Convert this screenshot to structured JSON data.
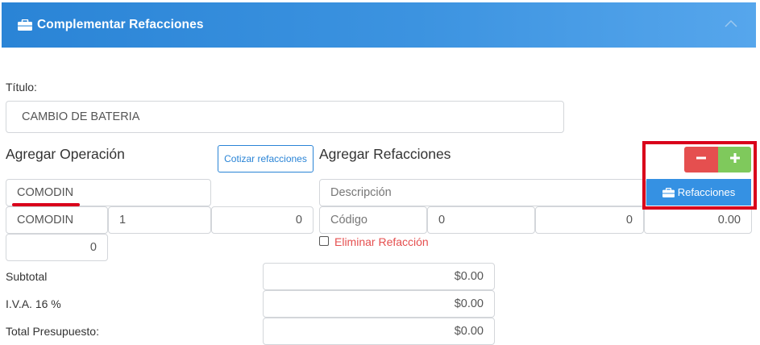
{
  "header": {
    "title": "Complementar Refacciones",
    "icon": "briefcase-icon",
    "collapse_icon": "chevron-up-icon"
  },
  "titulo": {
    "label": "Título:",
    "value": "CAMBIO DE BATERIA"
  },
  "operacion": {
    "heading": "Agregar Operación",
    "cotizar_label": "Cotizar refacciones",
    "name_value": "COMODIN",
    "row": [
      "COMODIN",
      "1",
      "0"
    ],
    "extra_value": "0"
  },
  "refacciones": {
    "heading": "Agregar Refacciones",
    "descripcion_placeholder": "Descripción",
    "codigo_placeholder": "Código",
    "row": [
      "0",
      "0",
      "0.00"
    ],
    "minus_label": "−",
    "plus_label": "+",
    "button_label": "Refacciones",
    "eliminar_label": "Eliminar Refacción"
  },
  "totals": {
    "subtotal_label": "Subtotal",
    "subtotal_value": "$0.00",
    "iva_label": "I.V.A. 16 %",
    "iva_value": "$0.00",
    "total_label": "Total Presupuesto:",
    "total_value": "$0.00"
  },
  "colors": {
    "header": "#2a84d6",
    "danger": "#e54f4f",
    "success": "#7fc95c",
    "highlight": "#d9001b"
  }
}
